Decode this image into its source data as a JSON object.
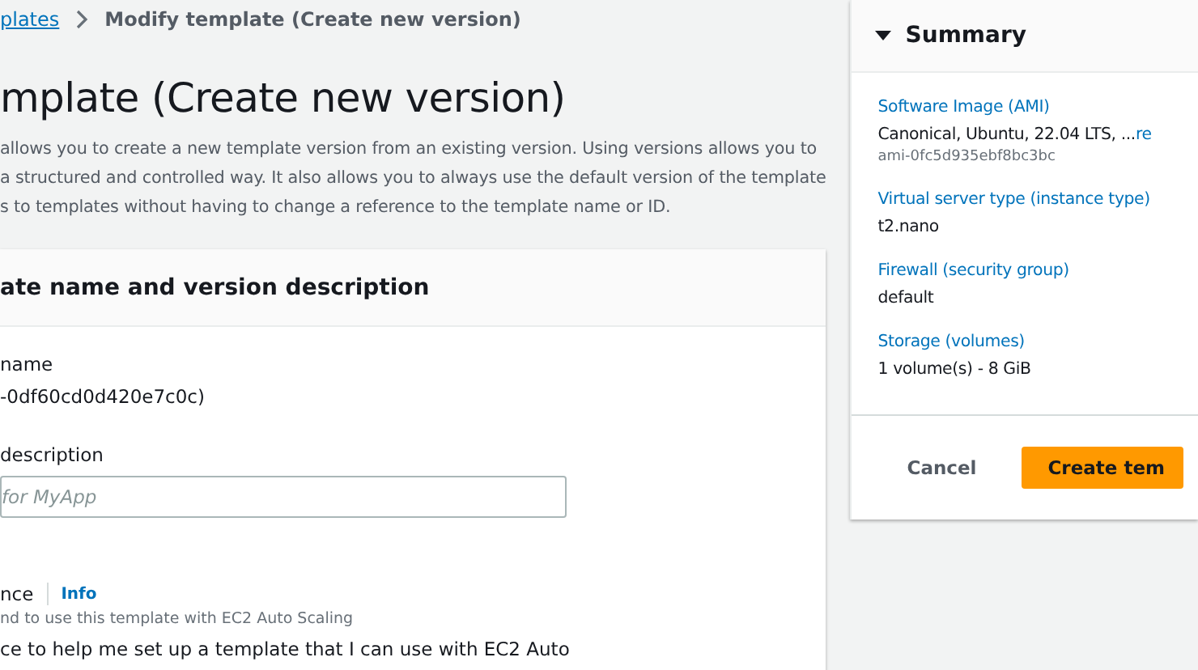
{
  "breadcrumb": [
    {
      "label": "plates",
      "kind": "link"
    },
    {
      "label": "Modify template (Create new version)",
      "kind": "current"
    }
  ],
  "title": "mplate (Create new version)",
  "description": [
    "allows you to create a new template version from an existing version. Using versions allows you to",
    "a structured and controlled way. It also allows you to always use the default version of the template",
    "s to templates without having to change a reference to the template name or ID."
  ],
  "card": {
    "title": "ate name and version description",
    "fields": [
      {
        "kind": "value",
        "label": "name",
        "value": "-0df60cd0d420e7c0c)"
      },
      {
        "kind": "input",
        "label": "description",
        "placeholder": "for MyApp"
      },
      {
        "kind": "guidance",
        "label": "nce",
        "info": "Info",
        "hint": "nd to use this template with EC2 Auto Scaling",
        "text": "ce to help me set up a template that I can use with EC2 Auto"
      }
    ]
  },
  "summary": {
    "title": "Summary",
    "expanded": true,
    "items": [
      {
        "label": "Software Image (AMI)",
        "value": "Canonical, Ubuntu, 22.04 LTS, ...",
        "link": "re",
        "sub": "ami-0fc5d935ebf8bc3bc"
      },
      {
        "label": "Virtual server type (instance type)",
        "value": "t2.nano"
      },
      {
        "label": "Firewall (security group)",
        "value": "default"
      },
      {
        "label": "Storage (volumes)",
        "value": "1 volume(s) - 8 GiB"
      }
    ],
    "buttons": [
      {
        "label": "Cancel",
        "kind": "secondary"
      },
      {
        "label": "Create tem",
        "kind": "primary"
      }
    ]
  }
}
